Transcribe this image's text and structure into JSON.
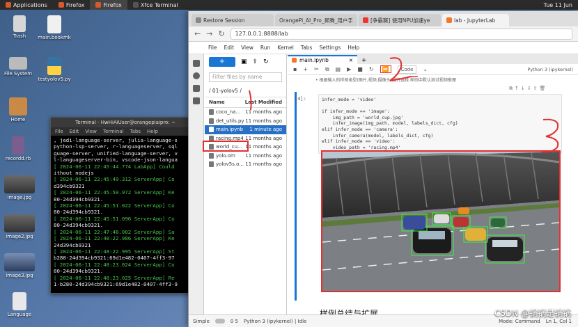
{
  "panel": {
    "tasks": [
      "Applications",
      "Firefox",
      "Firefox",
      "Xfce Terminal"
    ],
    "clock": "Tue 11 Jun"
  },
  "desktop": {
    "icons": [
      {
        "label": "Trash"
      },
      {
        "label": "main.bookmk"
      },
      {
        "label": "File System"
      },
      {
        "label": "testyolov5.py"
      },
      {
        "label": "Home"
      },
      {
        "label": "recordd.rb"
      },
      {
        "label": "image.jpg"
      },
      {
        "label": "image2.jpg"
      },
      {
        "label": "image3.jpg"
      },
      {
        "label": "Language"
      }
    ]
  },
  "terminal": {
    "title": "Terminal - HwHiAiUser@orangepiaipro: ~",
    "menu": [
      "File",
      "Edit",
      "View",
      "Terminal",
      "Tabs",
      "Help"
    ],
    "lines": [
      {
        "t": ", jedi-language-server, julia-language-s",
        "g": false
      },
      {
        "t": "python-lsp-server, r-languageserver, sql",
        "g": false
      },
      {
        "t": "guage-server, unified-language-server, v",
        "g": false
      },
      {
        "t": "l-languageserver-bin, vscode-json-langua",
        "g": false
      },
      {
        "t": "[ 2024-06-11 22:45:44.774 LabApp] Could",
        "g": true
      },
      {
        "t": "ithout nodejs",
        "g": false
      },
      {
        "t": "[ 2024-06-11 22:45:49.312 ServerApp] Co",
        "g": true
      },
      {
        "t": "d394cb9321",
        "g": false
      },
      {
        "t": "[ 2024-06-11 22:45:50.972 ServerApp] Ke",
        "g": true
      },
      {
        "t": "80-24d394cb9321.",
        "g": false
      },
      {
        "t": "[ 2024-06-11 22:45:51.022 ServerApp] Co",
        "g": true
      },
      {
        "t": "80-24d394cb9321.",
        "g": false
      },
      {
        "t": "[ 2024-06-11 22:45:51.096 ServerApp] Co",
        "g": true
      },
      {
        "t": "80-24d394cb9321.",
        "g": false
      },
      {
        "t": "[ 2024-06-11 22:47:48.002 ServerApp] Sa",
        "g": true
      },
      {
        "t": "[ 2024-06-11 22:48:22.986 ServerApp] Ke",
        "g": true
      },
      {
        "t": "24d394cb9321",
        "g": false
      },
      {
        "t": "[ 2024-06-11 22:48:22.995 ServerApp] St",
        "g": true
      },
      {
        "t": "b280-24d394cb9321:69d1e482-0407-4ff3-97",
        "g": false
      },
      {
        "t": "[ 2024-06-11 22:48:23.024 ServerApp] Co",
        "g": true
      },
      {
        "t": "80-24d394cb9321.",
        "g": false
      },
      {
        "t": "[ 2024-06-11 22:48:23.025 ServerApp] Re",
        "g": true
      },
      {
        "t": "1-b280-24d394cb9321:69d1e482-0407-4ff3-9",
        "g": false
      }
    ]
  },
  "browser": {
    "tabs": [
      "Restore Session",
      "OrangePi_AI_Pro_昇腾_用户手",
      "[争霸赛] 使用NPU加速ye",
      "lab - JupyterLab"
    ],
    "url": "127.0.0.1:8888/lab"
  },
  "jupyter": {
    "menu": [
      "File",
      "Edit",
      "View",
      "Run",
      "Kernel",
      "Tabs",
      "Settings",
      "Help"
    ],
    "filter_placeholder": "Filter files by name",
    "breadcrumb": "/ 01-yolov5 /",
    "col_name": "Name",
    "col_modified": "Last Modified",
    "files": [
      {
        "name": "coco_na...",
        "mod": "11 months ago"
      },
      {
        "name": "det_utils.py",
        "mod": "11 months ago"
      },
      {
        "name": "main.ipynb",
        "mod": "1 minute ago"
      },
      {
        "name": "racing.mp4",
        "mod": "11 months ago"
      },
      {
        "name": "world_cu...",
        "mod": "11 months ago"
      },
      {
        "name": "yolo.om",
        "mod": "11 months ago"
      },
      {
        "name": "yolov5s.o...",
        "mod": "11 months ago"
      }
    ],
    "notebook_tab": "main.ipynb",
    "cell_type": "Code",
    "kernel": "Python 3 (ipykernel)",
    "md_line": "• 根据输入的样例类型(图片,视频,摄像头)进行选择,样例中默认测试视频推理",
    "prompt": "[4]:",
    "heading": "样例总结与扩展",
    "status": {
      "mode": "Simple",
      "nums": "0  5",
      "kernel": "Python 3 (ipykernel) | Idle",
      "cell": "Mode: Command",
      "pos": "Ln 1, Col 1"
    }
  },
  "code_lines": [
    "infer_mode = 'video'",
    "",
    "if infer_mode == 'image':",
    "    img_path = 'world_cup.jpg'",
    "    infer_image(img_path, model, labels_dict, cfg)",
    "elif infer_mode == 'camera':",
    "    infer_camera(model, labels_dict, cfg)",
    "elif infer_mode == 'video':",
    "    video_path = 'racing.mp4'",
    "    infer_video(video_path, model, labels_dict, cfg)"
  ],
  "watermark": "CSDN @锅锅是锅锅",
  "colors": {
    "accent": "#1976d2",
    "annotation": "#e23030",
    "terminal_green": "#49c44a"
  }
}
